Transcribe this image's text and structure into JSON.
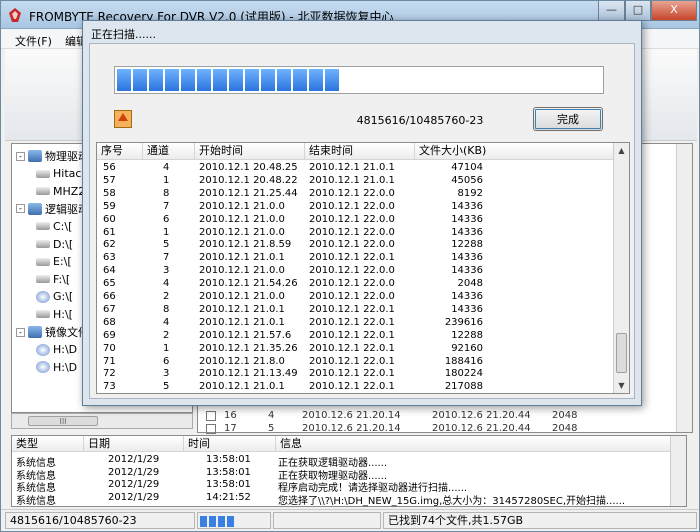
{
  "window": {
    "title": "FROMBYTE Recovery For DVR   V2.0 (试用版) - 北亚数据恢复中心",
    "min_label": "—",
    "max_label": "□",
    "close_label": "X"
  },
  "menu": [
    {
      "label": "文件(F)"
    },
    {
      "label": "编辑"
    }
  ],
  "tree": [
    {
      "label": "物理驱动",
      "icon": "computer-icon",
      "level": 0,
      "expander": "-"
    },
    {
      "label": "Hitach",
      "icon": "hard-drive-icon",
      "level": 1
    },
    {
      "label": "MHZ2",
      "icon": "hard-drive-icon",
      "level": 1
    },
    {
      "label": "逻辑驱动",
      "icon": "computer-icon",
      "level": 0,
      "expander": "-"
    },
    {
      "label": "C:\\[",
      "icon": "hard-drive-icon",
      "level": 1
    },
    {
      "label": "D:\\[",
      "icon": "hard-drive-icon",
      "level": 1
    },
    {
      "label": "E:\\[",
      "icon": "hard-drive-icon",
      "level": 1
    },
    {
      "label": "F:\\[",
      "icon": "hard-drive-icon",
      "level": 1
    },
    {
      "label": "G:\\[",
      "icon": "cdrom-icon",
      "level": 1
    },
    {
      "label": "H:\\[",
      "icon": "hard-drive-icon",
      "level": 1
    },
    {
      "label": "镜像文件",
      "icon": "computer-icon",
      "level": 0,
      "expander": "-"
    },
    {
      "label": "H:\\D",
      "icon": "disk-image-icon",
      "level": 1
    },
    {
      "label": "H:\\D",
      "icon": "disk-image-icon",
      "level": 1
    }
  ],
  "tree_scroll_label": "III",
  "background_rows": [
    {
      "no": "16",
      "ch": "4",
      "start": "2010.12.6 21.20.14",
      "end": "2010.12.6 21.20.44",
      "size": "2048"
    },
    {
      "no": "17",
      "ch": "5",
      "start": "2010.12.6 21.20.14",
      "end": "2010.12.6 21.20.44",
      "size": "2048"
    }
  ],
  "log": {
    "headers": [
      "类型",
      "日期",
      "时间",
      "信息"
    ],
    "rows": [
      [
        "系统信息",
        "2012/1/29",
        "13:58:01",
        "正在获取逻辑驱动器......"
      ],
      [
        "系统信息",
        "2012/1/29",
        "13:58:01",
        "正在获取物理驱动器......"
      ],
      [
        "系统信息",
        "2012/1/29",
        "13:58:01",
        "程序启动完成！请选择驱动器进行扫描......"
      ],
      [
        "系统信息",
        "2012/1/29",
        "14:21:52",
        "您选择了\\\\?\\H:\\DH_NEW_15G.img,总大小为：31457280SEC,开始扫描......"
      ]
    ]
  },
  "statusbar": {
    "progress_text": "4815616/10485760-23",
    "progress_fraction": 0.46,
    "found_text": "已找到74个文件,共1.57GB"
  },
  "dialog": {
    "title": "正在扫描......",
    "progress_fraction": 0.46,
    "progress_text": "4815616/10485760-23",
    "done_label": "完成",
    "headers": [
      "序号",
      "通道",
      "开始时间",
      "结束时间",
      "文件大小(KB)"
    ],
    "rows": [
      [
        "56",
        "4",
        "2010.12.1 20.48.25",
        "2010.12.1 21.0.1",
        "47104"
      ],
      [
        "57",
        "1",
        "2010.12.1 20.48.22",
        "2010.12.1 21.0.1",
        "45056"
      ],
      [
        "58",
        "8",
        "2010.12.1 21.25.44",
        "2010.12.1 22.0.0",
        "8192"
      ],
      [
        "59",
        "7",
        "2010.12.1 21.0.0",
        "2010.12.1 22.0.0",
        "14336"
      ],
      [
        "60",
        "6",
        "2010.12.1 21.0.0",
        "2010.12.1 22.0.0",
        "14336"
      ],
      [
        "61",
        "1",
        "2010.12.1 21.0.0",
        "2010.12.1 22.0.0",
        "14336"
      ],
      [
        "62",
        "5",
        "2010.12.1 21.8.59",
        "2010.12.1 22.0.0",
        "12288"
      ],
      [
        "63",
        "7",
        "2010.12.1 21.0.1",
        "2010.12.1 22.0.1",
        "14336"
      ],
      [
        "64",
        "3",
        "2010.12.1 21.0.0",
        "2010.12.1 22.0.0",
        "14336"
      ],
      [
        "65",
        "4",
        "2010.12.1 21.54.26",
        "2010.12.1 22.0.0",
        "2048"
      ],
      [
        "66",
        "2",
        "2010.12.1 21.0.0",
        "2010.12.1 22.0.0",
        "14336"
      ],
      [
        "67",
        "8",
        "2010.12.1 21.0.1",
        "2010.12.1 22.0.1",
        "14336"
      ],
      [
        "68",
        "4",
        "2010.12.1 21.0.1",
        "2010.12.1 22.0.1",
        "239616"
      ],
      [
        "69",
        "2",
        "2010.12.1 21.57.6",
        "2010.12.1 22.0.1",
        "12288"
      ],
      [
        "70",
        "1",
        "2010.12.1 21.35.26",
        "2010.12.1 22.0.1",
        "92160"
      ],
      [
        "71",
        "6",
        "2010.12.1 21.8.0",
        "2010.12.1 22.0.1",
        "188416"
      ],
      [
        "72",
        "3",
        "2010.12.1 21.13.49",
        "2010.12.1 22.0.1",
        "180224"
      ],
      [
        "73",
        "5",
        "2010.12.1 21.0.1",
        "2010.12.1 22.0.1",
        "217088"
      ]
    ]
  }
}
